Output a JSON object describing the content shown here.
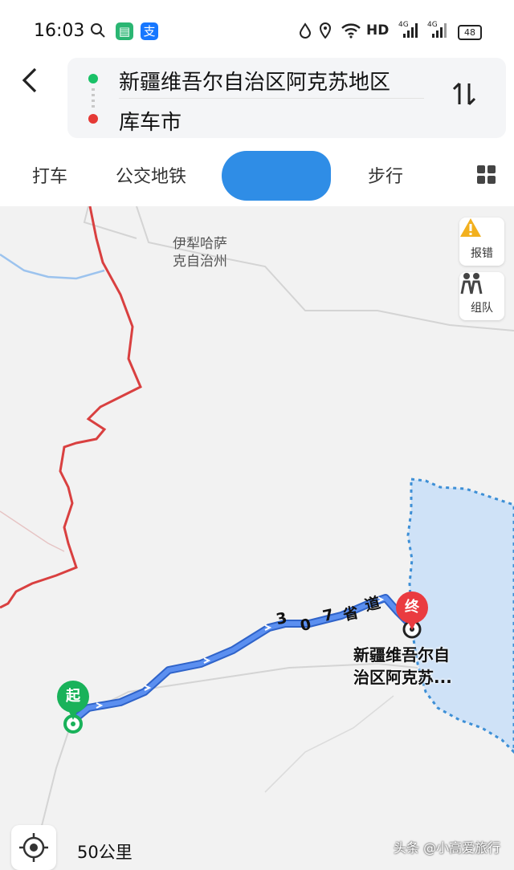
{
  "status_bar": {
    "time": "16:03",
    "network_label": "HD",
    "signal_1": "4G",
    "signal_2": "4G",
    "battery": "48"
  },
  "header": {
    "back_icon": "chevron-left-icon",
    "origin": "新疆维吾尔自治区阿克苏地区",
    "destination": "库车市",
    "swap_icon": "swap-vertical-icon"
  },
  "tabs": [
    {
      "label": "打车"
    },
    {
      "label": "公交地铁"
    },
    {
      "label": ""
    },
    {
      "label": "步行"
    }
  ],
  "map": {
    "region_label_line1": "伊犁哈萨",
    "region_label_line2": "克自治州",
    "road_chars": [
      "3",
      "0",
      "7",
      "省",
      "道"
    ],
    "start_marker": "起",
    "end_marker": "终",
    "dest_line1": "新疆维吾尔自",
    "dest_line2": "治区阿克苏...",
    "scale": "50公里",
    "colors": {
      "route": "#4a80e8",
      "border": "#d94040",
      "water": "#cfe2f7",
      "start": "#19b25a",
      "end": "#ea3b40"
    }
  },
  "side_buttons": {
    "report": "报错",
    "team": "组队"
  },
  "watermark": "头条 @小高爱旅行"
}
